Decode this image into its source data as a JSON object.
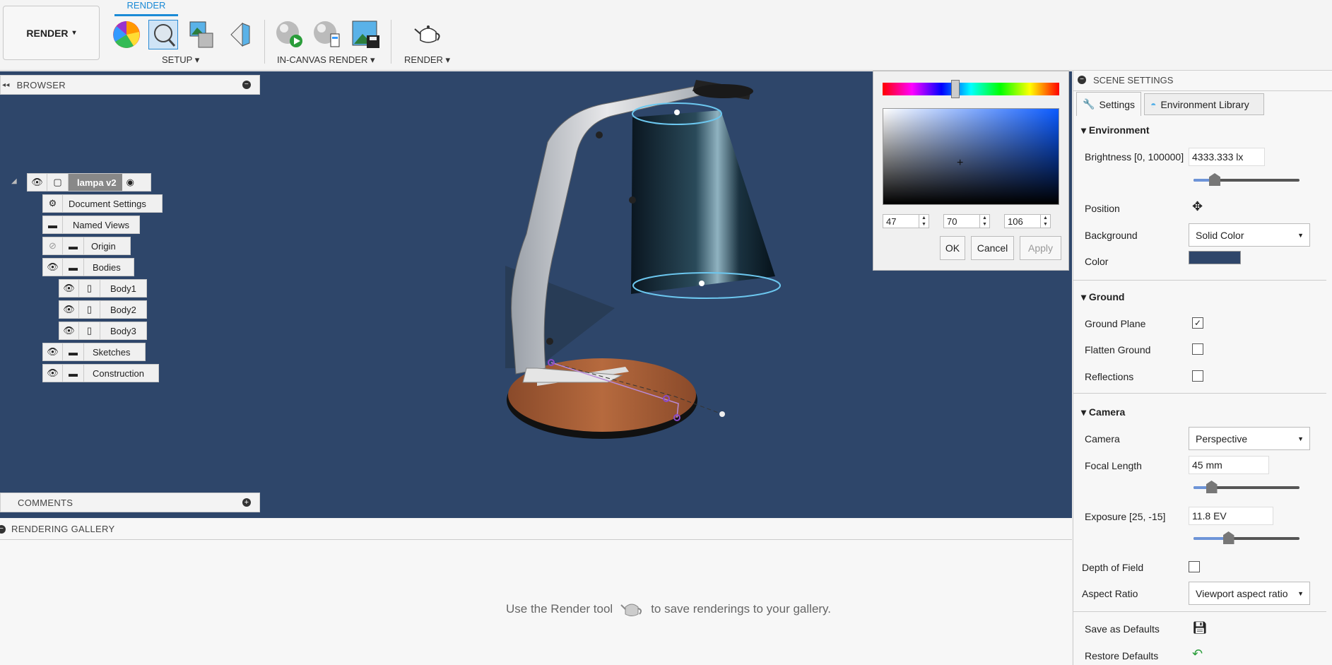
{
  "toolbar": {
    "workspace": "RENDER",
    "workspace_caret": "▾",
    "active_tab": "RENDER",
    "groups": [
      "SETUP ▾",
      "IN-CANVAS RENDER ▾",
      "RENDER ▾"
    ]
  },
  "browser": {
    "title": "BROWSER",
    "root": "lampa v2",
    "nodes": [
      "Document Settings",
      "Named Views",
      "Origin",
      "Bodies",
      "Body1",
      "Body2",
      "Body3",
      "Sketches",
      "Construction"
    ]
  },
  "comments": {
    "title": "COMMENTS"
  },
  "gallery": {
    "title": "RENDERING GALLERY",
    "hint_before": "Use the Render tool",
    "hint_after": "to save renderings to your gallery."
  },
  "color_picker": {
    "r": "47",
    "g": "70",
    "b": "106",
    "ok": "OK",
    "cancel": "Cancel",
    "apply": "Apply",
    "hue_position": 0.41,
    "selected_color": "#2f466a"
  },
  "scene": {
    "title": "SCENE SETTINGS",
    "tabs": [
      "Settings",
      "Environment Library"
    ],
    "environment": {
      "title": "Environment",
      "brightness_label": "Brightness [0, 100000]",
      "brightness": "4333.333 lx",
      "brightness_slider": 0.2,
      "position_label": "Position",
      "background_label": "Background",
      "background": "Solid Color",
      "color_label": "Color",
      "color": "#2f466a"
    },
    "ground": {
      "title": "Ground",
      "ground_plane": "Ground Plane",
      "ground_plane_checked": true,
      "flatten": "Flatten Ground",
      "flatten_checked": false,
      "reflections": "Reflections",
      "reflections_checked": false
    },
    "camera": {
      "title": "Camera",
      "camera_label": "Camera",
      "camera": "Perspective",
      "focal_label": "Focal Length",
      "focal": "45 mm",
      "focal_slider": 0.17,
      "exposure_label": "Exposure [25, -15]",
      "exposure": "11.8 EV",
      "exposure_slider": 0.33,
      "dof": "Depth of Field",
      "dof_checked": false,
      "aspect_label": "Aspect Ratio",
      "aspect": "Viewport aspect ratio"
    },
    "save_defaults": "Save as Defaults",
    "restore_defaults": "Restore Defaults"
  },
  "colors": {
    "accent": "#1a8ad6",
    "viewport_bg": "#2e466a"
  }
}
